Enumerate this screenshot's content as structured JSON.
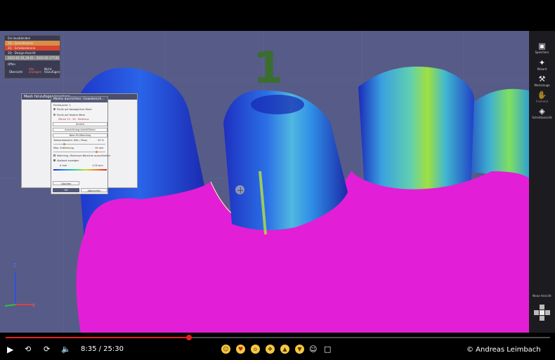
{
  "video": {
    "time_current": "8:35",
    "time_total": "25:30",
    "time_display": "8:35 / 25:30",
    "progress_fraction": 0.337,
    "watermark": "© Andreas Leimbach"
  },
  "viewport": {
    "big_number": "1",
    "axis_label_z": "Z",
    "axis_label_x": "X"
  },
  "object_panel": {
    "rows": [
      "Ein-/ausblenden",
      "2Q - Gesichtsscan",
      "2Q - Scheibenkrone",
      "2Q - Design-Ansicht",
      "2023-02-16_18-01 - 2024-02-17T-00_gescannter"
    ],
    "btn_ubersicht": "Übersicht",
    "btn_alle": "Alle anzeigen",
    "btn_nicht": "Nicht hinzufügen",
    "item_offen": "Offen"
  },
  "dialog_back": {
    "title": "Mesh hinzufügen/ersetzen"
  },
  "dialog": {
    "title": "Meshs ausrichten: Gewebesch...",
    "lines": [
      "Punktsuche: 1",
      "Punkt auf bewegliches Mesh",
      "Punkt auf festem Mesh",
      "Zähne 15 - 26 - Referenz"
    ],
    "btn_zuruck": "Zurück",
    "btn_ausrichtung": "Ausrichtung durchführen",
    "btn_bestfit": "Best-Fit-Matching",
    "label_toleranz": "Toleranzbereich (Min / Max)",
    "val_toleranz": "20 %",
    "label_max": "Max. Entfernung",
    "val_max": "10 mm",
    "cb_matching": "Matching, Maximum-Bereiche ausschließen",
    "cb_abstand": "Abstand anzeigen",
    "val_scale_min": "0 mm",
    "val_scale_max": "1.00 mm",
    "btn_loschen": "Löschen",
    "btn_ok": "OK",
    "btn_abbrechen": "Abbrechen"
  },
  "right_toolbar": {
    "items": [
      {
        "label": "Speichern",
        "icon": "save-icon"
      },
      {
        "label": "Wizard",
        "icon": "wand-icon"
      },
      {
        "label": "Werkzeuge",
        "icon": "tools-icon"
      },
      {
        "label": "Freihand",
        "icon": "hand-icon"
      },
      {
        "label": "Schnittansicht",
        "icon": "gamepad-icon"
      }
    ],
    "bottom_label": "Neue Ansicht"
  },
  "colors": {
    "accent": "#e52020",
    "viewport_bg": "#575b88",
    "gum": "#e21fd6"
  }
}
